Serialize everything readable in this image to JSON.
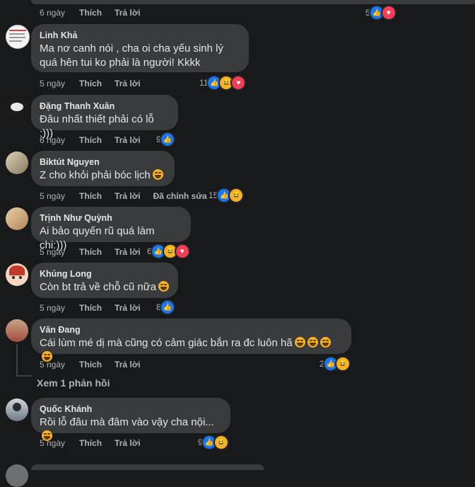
{
  "actions": {
    "like": "Thích",
    "reply": "Trả lời",
    "edited": "Đã chỉnh sửa"
  },
  "top_actions": {
    "time": "6 ngày",
    "count": "5"
  },
  "comments": [
    {
      "name": "Linh Khả",
      "text": "Ma nơ canh nói , cha oi cha yếu sinh lý quá hên tui ko phải là người! Kkkk",
      "time": "5 ngày",
      "count": "11",
      "reactions": [
        "like",
        "haha",
        "love"
      ]
    },
    {
      "name": "Đặng Thanh Xuân",
      "text": "Đâu nhất thiết phải có lỗ :)))",
      "time": "6 ngày",
      "count": "9",
      "reactions": [
        "like"
      ]
    },
    {
      "name": "Biktút Nguyen",
      "text": "Z cho khỏi phải bóc lịch",
      "time": "5 ngày",
      "count": "15",
      "reactions": [
        "like",
        "haha"
      ]
    },
    {
      "name": "Trịnh Như Quỳnh",
      "text": "Ai bảo quyến rũ quá làm chi:)))",
      "time": "5 ngày",
      "count": "6",
      "reactions": [
        "like",
        "haha",
        "love"
      ]
    },
    {
      "name": "Khủng Long",
      "text": "Còn bt trả về chỗ cũ nữa",
      "time": "5 ngày",
      "count": "8",
      "reactions": [
        "like"
      ]
    },
    {
      "name": "Văn Đang",
      "text": "Cái lùm mé dị mà cũng có cảm giác bắn ra đc luôn hã",
      "time": "5 ngày",
      "count": "2",
      "reactions": [
        "like",
        "haha"
      ]
    },
    {
      "name": "Quốc Khánh",
      "text": "Rồi lỗ đâu mà đâm vào vậy cha nội...",
      "time": "5 ngày",
      "count": "9",
      "reactions": [
        "like",
        "haha"
      ]
    }
  ],
  "view_replies": "Xem 1 phản hồi",
  "colors": {
    "background": "#18191a",
    "bubble": "#3a3b3c",
    "like": "#1877f2",
    "haha": "#f7b125",
    "love": "#f33e58"
  }
}
